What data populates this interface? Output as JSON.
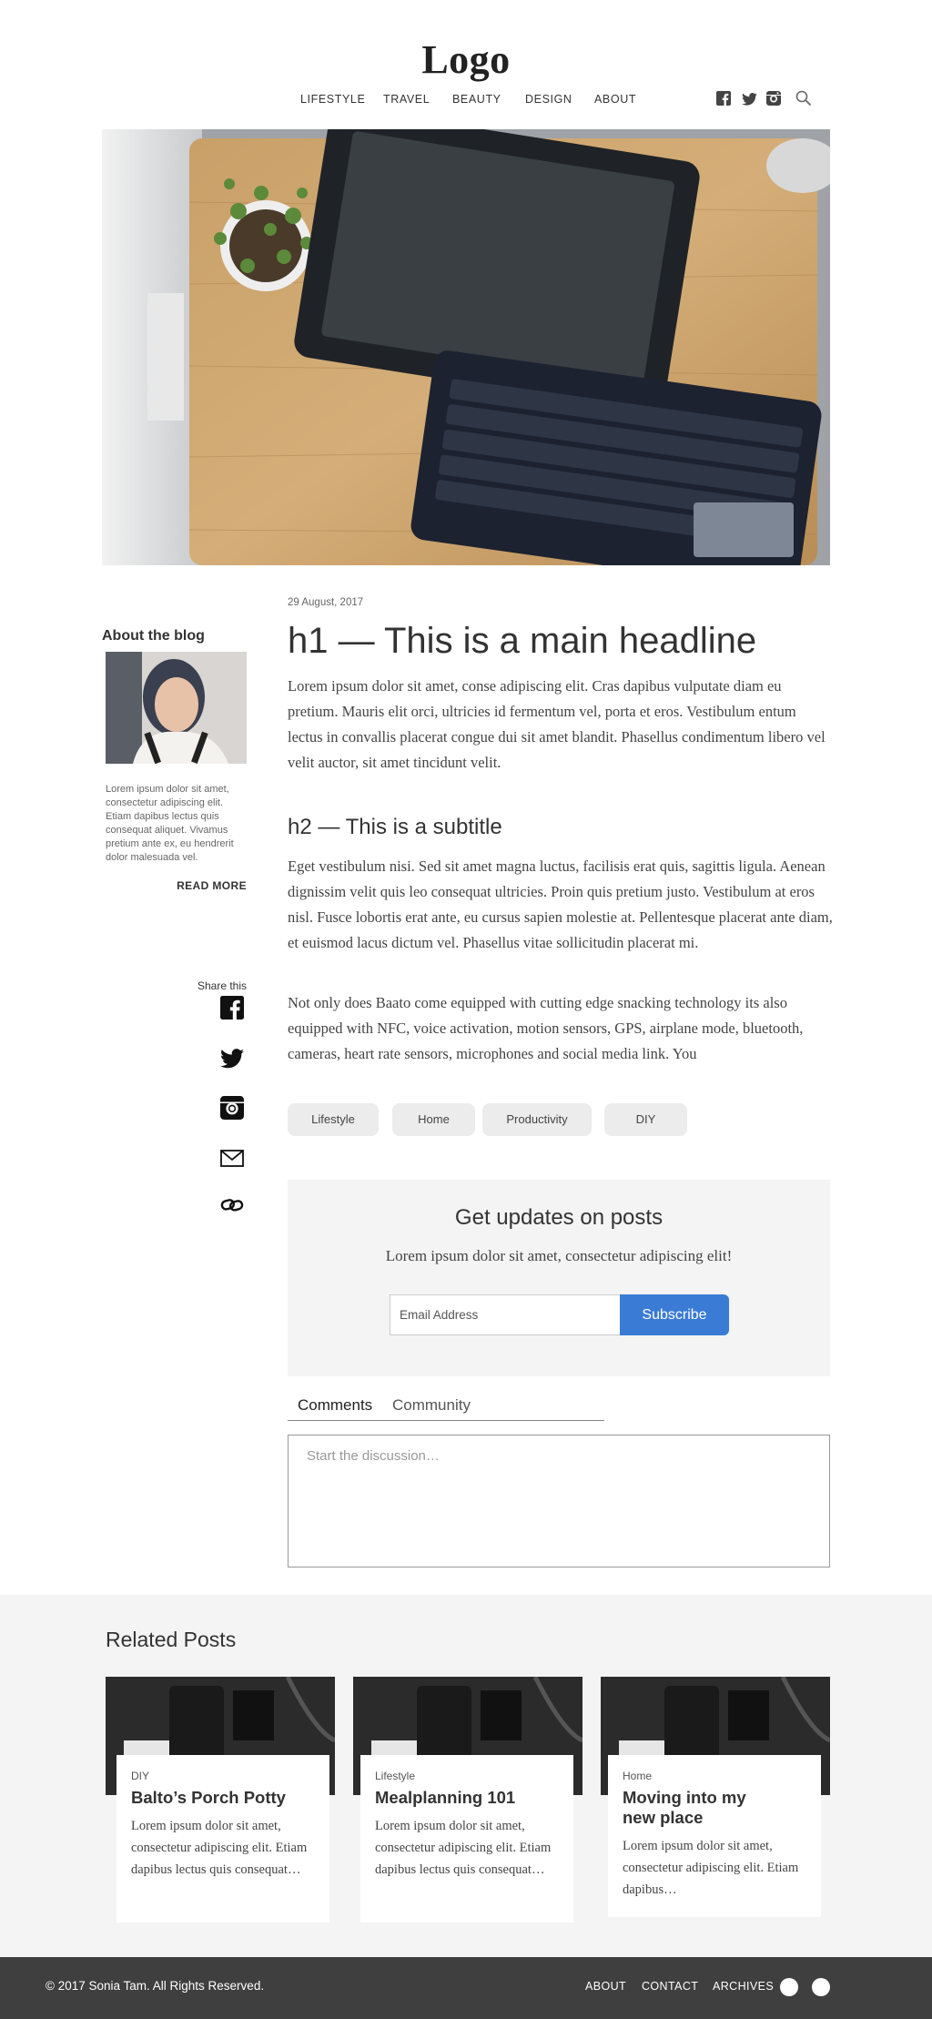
{
  "header": {
    "logo": "Logo",
    "nav": [
      "LIFESTYLE",
      "TRAVEL",
      "BEAUTY",
      "DESIGN",
      "ABOUT"
    ],
    "social_icons": [
      "facebook-icon",
      "twitter-icon",
      "instagram-icon",
      "search-icon"
    ]
  },
  "sidebar": {
    "about_title": "About the blog",
    "about_text": "Lorem ipsum dolor sit amet, consectetur adipiscing elit. Etiam dapibus lectus quis consequat aliquet. Vivamus pretium ante ex, eu hendrerit dolor malesuada vel.",
    "read_more": "READ MORE",
    "share_label": "Share this",
    "share_icons": [
      "facebook-icon",
      "twitter-icon",
      "instagram-icon",
      "mail-icon",
      "link-icon"
    ]
  },
  "article": {
    "date": "29 August, 2017",
    "h1": "h1 — This is a main headline",
    "p1": "Lorem ipsum dolor sit amet, conse adipiscing elit. Cras dapibus vulputate diam eu pretium. Mauris elit orci, ultricies id fermentum vel, porta et eros. Vestibulum entum lectus in convallis placerat congue dui sit amet blandit. Phasellus condimentum libero vel velit auctor, sit amet tincidunt velit.",
    "h2": "h2 — This is a subtitle",
    "p2": "Eget vestibulum nisi. Sed sit amet magna luctus, facilisis erat quis, sagittis ligula. Aenean dignissim velit quis leo consequat ultricies. Proin quis pretium justo. Vestibulum at eros nisl. Fusce lobortis erat ante, eu cursus sapien molestie at. Pellentesque placerat ante diam, et euismod lacus dictum vel. Phasellus vitae sollicitudin placerat mi.",
    "p3": "Not only does Baato come equipped with cutting edge snacking technology its also equipped with NFC, voice activation, motion sensors, GPS, airplane mode, bluetooth, cameras, heart rate sensors, microphones and social media link. You",
    "tags": [
      "Lifestyle",
      "Home",
      "Productivity",
      "DIY"
    ]
  },
  "subscribe": {
    "title": "Get updates on posts",
    "text": "Lorem ipsum dolor sit amet, consectetur adipiscing elit!",
    "email_placeholder": "Email Address",
    "button": "Subscribe"
  },
  "comments": {
    "tabs": [
      "Comments",
      "Community"
    ],
    "active_tab": "Comments",
    "placeholder": "Start the discussion…"
  },
  "related": {
    "title": "Related Posts",
    "posts": [
      {
        "category": "DIY",
        "title": "Balto’s Porch Potty",
        "text": "Lorem ipsum dolor sit amet, consectetur adipiscing elit. Etiam dapibus lectus quis consequat…"
      },
      {
        "category": "Lifestyle",
        "title": "Mealplanning 101",
        "text": "Lorem ipsum dolor sit amet, consectetur adipiscing elit. Etiam dapibus lectus quis consequat…"
      },
      {
        "category": "Home",
        "title": "Moving into my new place",
        "text": "Lorem ipsum dolor sit amet, consectetur adipiscing elit. Etiam dapibus…"
      }
    ]
  },
  "footer": {
    "copyright": "© 2017 Sonia Tam. All Rights Reserved.",
    "links": [
      "ABOUT",
      "CONTACT",
      "ARCHIVES"
    ]
  },
  "colors": {
    "accent": "#3a7bd5",
    "footer_bg": "#3f3f3f",
    "panel_bg": "#f4f4f4"
  }
}
